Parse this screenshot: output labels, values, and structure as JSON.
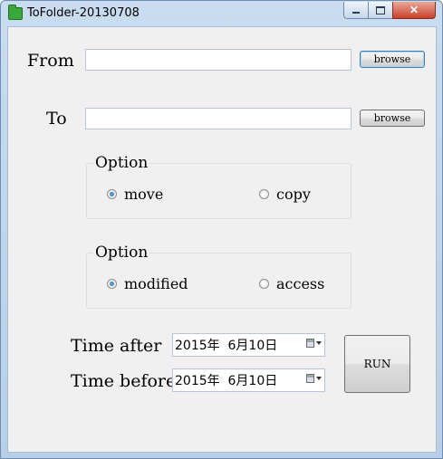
{
  "window": {
    "title": "ToFolder-20130708",
    "controls": {
      "minimize": "minimize",
      "maximize": "maximize",
      "close": "✕"
    }
  },
  "from": {
    "label": "From",
    "value": "",
    "browse_label": "browse"
  },
  "to": {
    "label": "To",
    "value": "",
    "browse_label": "browse"
  },
  "option1": {
    "title": "Option",
    "options": [
      {
        "label": "move",
        "selected": true
      },
      {
        "label": "copy",
        "selected": false
      }
    ]
  },
  "option2": {
    "title": "Option",
    "options": [
      {
        "label": "modified",
        "selected": true
      },
      {
        "label": "access",
        "selected": false
      }
    ]
  },
  "time_after": {
    "label": "Time after",
    "value": "2015年  6月10日"
  },
  "time_before": {
    "label": "Time before",
    "value": "2015年  6月10日"
  },
  "run_label": "RUN"
}
